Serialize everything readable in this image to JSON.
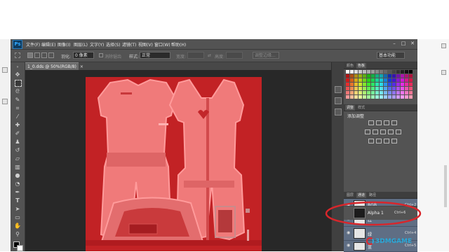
{
  "app": {
    "logo": "Ps",
    "menu": [
      "文件(F)",
      "编辑(E)",
      "图像(I)",
      "图层(L)",
      "文字(Y)",
      "选择(S)",
      "滤镜(T)",
      "视图(V)",
      "窗口(W)",
      "帮助(H)"
    ],
    "window_controls": [
      "–",
      "□",
      "✕"
    ]
  },
  "options": {
    "feather_label": "羽化:",
    "feather_value": "0 像素",
    "antialias_label": "消除锯齿",
    "style_label": "样式:",
    "style_value": "正常",
    "width_label": "宽度:",
    "height_label": "高度:",
    "refine_edge": "调整边缘...",
    "workspace": "基本功能"
  },
  "document": {
    "tab_title": "1_0.dds @ 50%(RGB/8)"
  },
  "panels": {
    "color_tab": "颜色",
    "swatches_tab": "色板",
    "adjustments_tab": "调整",
    "styles_tab": "样式",
    "add_adjustment": "添加调整",
    "layers_tab": "图层",
    "channels_tab": "通道",
    "paths_tab": "路径",
    "channels": [
      {
        "name": "RGB",
        "shortcut": "Ctrl+2"
      },
      {
        "name": "红",
        "shortcut": "Ctrl+3"
      },
      {
        "name": "绿",
        "shortcut": "Ctrl+4"
      },
      {
        "name": "蓝",
        "shortcut": "Ctrl+5"
      },
      {
        "name": "Alpha 1",
        "shortcut": "Ctrl+6"
      }
    ]
  },
  "highlight_color": "#d8262b",
  "watermark": "3DMGAME"
}
